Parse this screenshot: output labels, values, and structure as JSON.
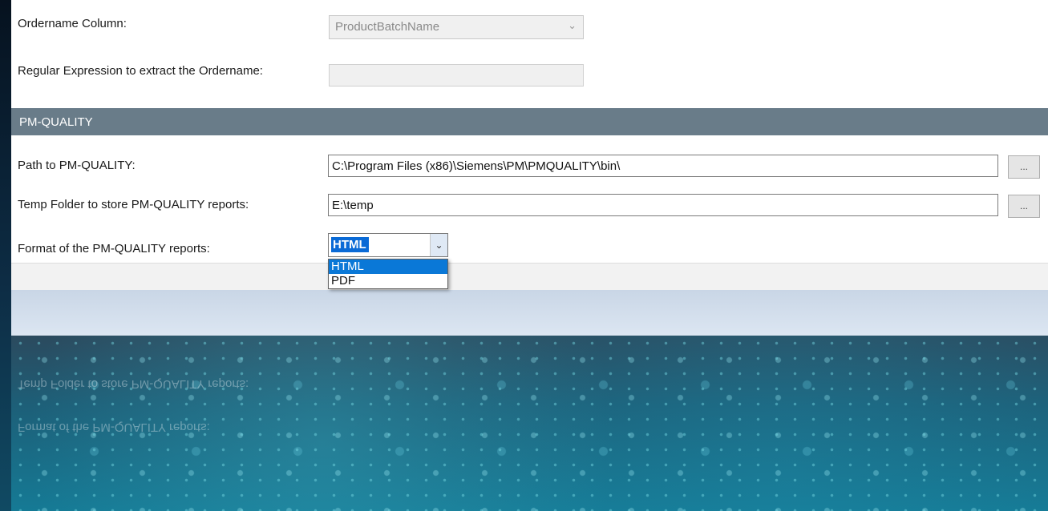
{
  "form": {
    "ordername_column_label": "Ordername Column:",
    "ordername_column_value": "ProductBatchName",
    "regex_label": "Regular Expression to extract the Ordername:",
    "regex_value": ""
  },
  "section": {
    "title": "PM-QUALITY"
  },
  "pmq": {
    "path_label": "Path to PM-QUALITY:",
    "path_value": "C:\\Program Files (x86)\\Siemens\\PM\\PMQUALITY\\bin\\",
    "temp_label": "Temp Folder to store PM-QUALITY reports:",
    "temp_value": "E:\\temp",
    "browse_label": "...",
    "format_label": "Format of the PM-QUALITY reports:",
    "format_value": "HTML",
    "format_options": [
      "HTML",
      "PDF"
    ]
  },
  "icons": {
    "chevron": "chevron-down-icon"
  },
  "colors": {
    "section_header": "#697c89",
    "selection": "#0a78d7"
  }
}
